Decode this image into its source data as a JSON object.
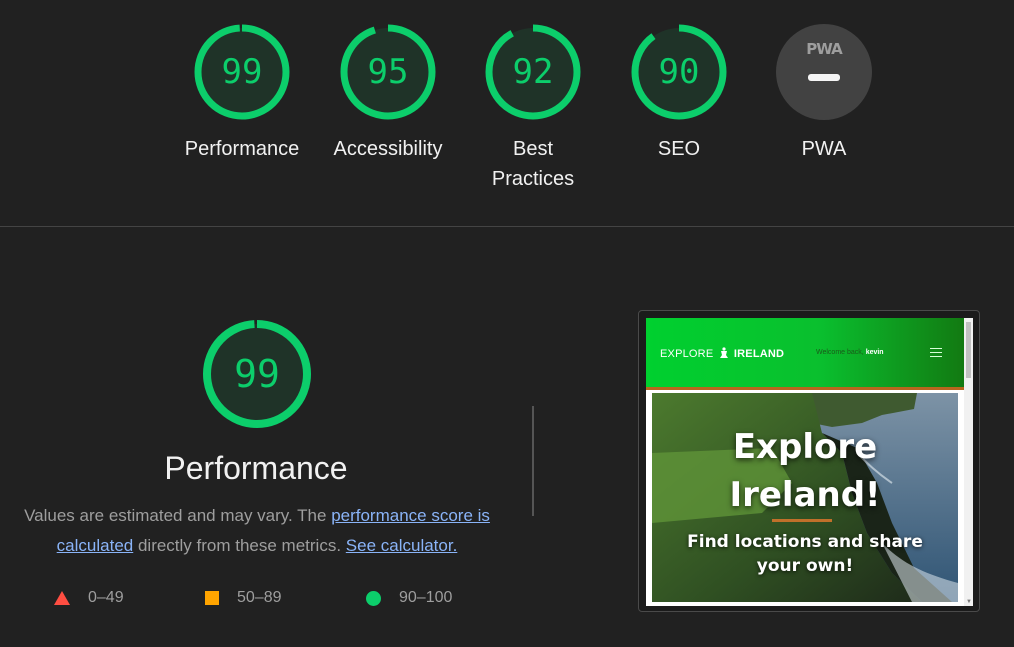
{
  "summary": {
    "categories": [
      {
        "label": "Performance",
        "score": "99",
        "value": 99
      },
      {
        "label": "Accessibility",
        "score": "95",
        "value": 95
      },
      {
        "label": "Best Practices",
        "score": "92",
        "value": 92
      },
      {
        "label": "SEO",
        "score": "90",
        "value": 90
      }
    ],
    "pwa": {
      "label": "PWA",
      "badge_text": "PWA"
    }
  },
  "performance": {
    "score": "99",
    "value": 99,
    "title": "Performance",
    "desc_prefix": "Values are estimated and may vary. The ",
    "score_link": "performance score is calculated",
    "desc_middle": " directly from these metrics. ",
    "calculator_link": "See calculator."
  },
  "legend": {
    "fail": "0–49",
    "average": "50–89",
    "pass": "90–100"
  },
  "screenshot": {
    "brand_prefix": "EXPLORE",
    "brand_name": "IRELAND",
    "welcome_text": "Welcome back,",
    "username": "kevin",
    "hero_title_line1": "Explore",
    "hero_title_line2": "Ireland!",
    "hero_sub_line1": "Find locations and share",
    "hero_sub_line2": "your own!"
  },
  "colors": {
    "background": "#212121",
    "pass": "#0cce6b",
    "average": "#ffa400",
    "fail": "#ff4e42",
    "link": "#8ab4f8",
    "pwa_badge": "#424242"
  },
  "icons": {
    "legend_fail": "red-triangle-icon",
    "legend_average": "orange-square-icon",
    "legend_pass": "green-circle-icon",
    "pwa_badge": "pwa-dash-icon",
    "brand_logo": "celtic-figure-icon",
    "menu": "hamburger-icon"
  }
}
